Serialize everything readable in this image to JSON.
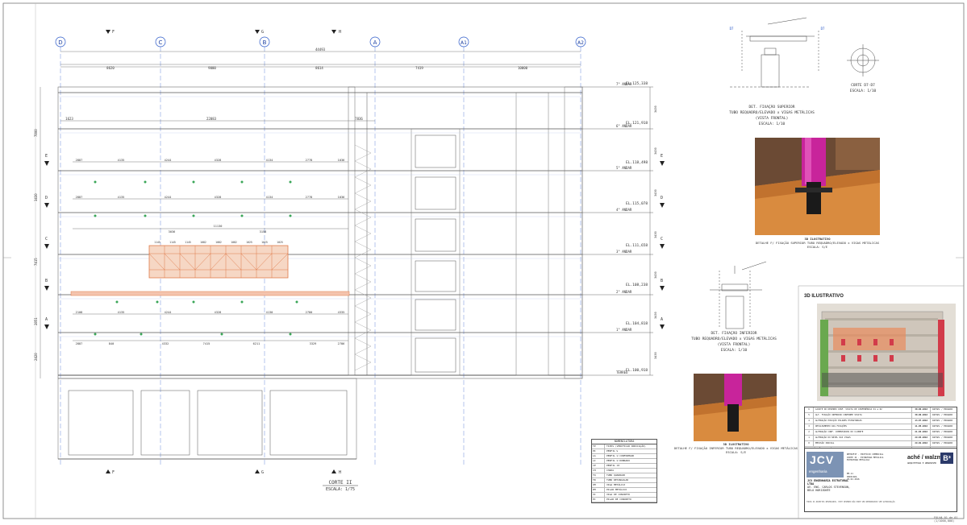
{
  "sheet": {
    "section_title": "CORTE II",
    "section_scale": "ESCALA: 1/75",
    "page_stamp": "FOLHA 01 de 01 (1/1000,000)"
  },
  "axes_top": [
    "D",
    "C",
    "B",
    "A",
    "A1",
    "A2"
  ],
  "section_marks": {
    "top": [
      "F",
      "G",
      "H"
    ],
    "bottom": [
      "F",
      "G",
      "H"
    ]
  },
  "dimensions": {
    "overall": "44493",
    "spans": [
      "8620",
      "9000",
      "8614",
      "7419",
      "10000"
    ],
    "row_top": [
      "1623",
      "22083",
      "7836"
    ],
    "row_a": [
      "2887",
      "4135",
      "4244",
      "4328",
      "4134",
      "2778",
      "1036"
    ],
    "row_b": [
      "3036",
      "11130",
      "3158"
    ],
    "row_c": [
      "2108",
      "4135",
      "4244",
      "4328",
      "4130",
      "2780",
      "4335"
    ],
    "row_d": [
      "2887",
      "840",
      "4332",
      "7415",
      "6211",
      "3329",
      "2786"
    ],
    "truss": [
      "1145",
      "1145",
      "1145",
      "1082",
      "1082",
      "1082",
      "1025",
      "1025",
      "1025"
    ],
    "left_side": [
      "7800",
      "3430",
      "7415",
      "2851",
      "2420"
    ],
    "right_side": [
      "3430",
      "3430",
      "3430",
      "3430",
      "3430",
      "3430",
      "3430"
    ]
  },
  "levels": [
    {
      "name": "7° ANDAR",
      "el": "EL.125,338"
    },
    {
      "name": "6° ANDAR",
      "el": "EL.121,918"
    },
    {
      "name": "5° ANDAR",
      "el": "EL.118,498"
    },
    {
      "name": "4° ANDAR",
      "el": "EL.115,078"
    },
    {
      "name": "3° ANDAR",
      "el": "EL.111,658"
    },
    {
      "name": "2° ANDAR",
      "el": "EL.108,238"
    },
    {
      "name": "1° ANDAR",
      "el": "EL.104,818"
    },
    {
      "name": "TÉRREO",
      "el": "EL.100,918"
    }
  ],
  "side_marks": [
    "E",
    "D",
    "C",
    "B",
    "A"
  ],
  "details": {
    "upper_title": "DET. FIXAÇÃO SUPERIOR",
    "upper_sub": "TUBO REQUADRO/ELEVADO x VIGAS METÁLICAS",
    "upper_view": "(VISTA FRONTAL)",
    "upper_scale": "ESCALA: 1/10",
    "cut_title": "CORTE D7-D7",
    "cut_scale": "ESCALA: 1/10",
    "cut_marks": [
      "D7",
      "D7"
    ],
    "lower_title": "DET. FIXAÇÃO INFERIOR",
    "lower_sub": "TUBO REQUADRO/ELEVADO x VIGAS METÁLICAS",
    "lower_view": "(VISTA FRONTAL)",
    "lower_scale": "ESCALA: 1/10",
    "photo1_caption_1": "3D ILUSTRATIVO",
    "photo1_caption_2": "DETALHE F/ FIXAÇÃO SUPERIOR TUBO REQUADRO/ELEVADO x VIGAS METÁLICAS",
    "photo1_caption_3": "ESCALA: S/E",
    "photo2_caption_1": "3D ILUSTRATIVO",
    "photo2_caption_2": "DETALHE F/ FIXAÇÃO INFERIOR TUBO REQUADRO/ELEVADO x VIGAS METÁLICAS",
    "photo2_caption_3": "ESCALA: S/E"
  },
  "render3d_title": "3D ILUSTRATIVO",
  "legend": {
    "title": "NOMENCLATURA",
    "rows": [
      [
        "TP",
        "TIPOS (VERIFICAR INDICAÇÃO)"
      ],
      [
        "PI",
        "PERFIL W"
      ],
      [
        "LA",
        "PERFIL U CONFORMADO"
      ],
      [
        "LI",
        "PERFIL U DOBRADO"
      ],
      [
        "CP",
        "PERFIL CP"
      ],
      [
        "CH",
        "CHAPA"
      ],
      [
        "TQ",
        "TUBO QUADRADO"
      ],
      [
        "TR",
        "TUBO RETANGULAR"
      ],
      [
        "VM",
        "VIGA METÁLICA"
      ],
      [
        "PM",
        "PILAR METÁLICO"
      ],
      [
        "VC",
        "VIGA DE CONCRETO"
      ],
      [
        "PC",
        "PILAR DE CONCRETO"
      ]
    ]
  },
  "revisions": {
    "rows": [
      [
        "6",
        "AJUSTE DO DESENHO CONF. VISITA DE CONFERÊNCIA 01 e 02",
        "30.06.2016",
        "RAFAEL / EDUARDO"
      ],
      [
        "5",
        "ALT. FIXAÇÃO INFERIOR CONFORME VISITA",
        "30.06.2016",
        "RAFAEL / EDUARDO"
      ],
      [
        "4",
        "ALTERAÇÃO POSIÇÃO PILARES ESTRUTURAIS",
        "13.07.2016",
        "RAFAEL / EDUARDO"
      ],
      [
        "3",
        "DETALHAMENTO DAS FIXAÇÕES",
        "11.05.2016",
        "RAFAEL / EDUARDO"
      ],
      [
        "2",
        "ALTERAÇÃO CONF. COMENTÁRIOS DO CLIENTE",
        "21.03.2016",
        "RAFAEL / EDUARDO"
      ],
      [
        "1",
        "ALTERAÇÃO DO NÍVEL DAS VIGAS",
        "29.03.2016",
        "RAFAEL / EDUARDO"
      ],
      [
        "0",
        "EMISSÃO INICIAL",
        "29.02.2016",
        "RAFAEL / EDUARDO"
      ]
    ],
    "header": [
      "REVISÃO",
      "DESCRIÇÃO",
      "DATA",
      "VISTO"
    ]
  },
  "titleblock": {
    "logo": "JCV",
    "logo_sub": "engenharia",
    "company": "JCV ENGENHARIA ESTRUTURAL LTDA",
    "company_addr": "AV. ENG. CARLOS STEVENSON, BELO HORIZONTE",
    "firm": "aché / walzmuth",
    "firm_info": "ARQUITETURA E URBANISMO",
    "b3": "B³",
    "project": "RETROFIT - EDIFÍCIO COMERCIAL",
    "drawing": "CORTE II - ESTRUTURA METÁLICA",
    "discipline": "ESTRUTURA METÁLICA",
    "sheet_no": "EM-11",
    "scale": "INDICADA",
    "date": "29.02.2016",
    "footer": "TODOS OS DIREITOS RESERVADOS. ESTE DESENHO NÃO PODE SER REPRODUZIDO SEM AUTORIZAÇÃO."
  }
}
